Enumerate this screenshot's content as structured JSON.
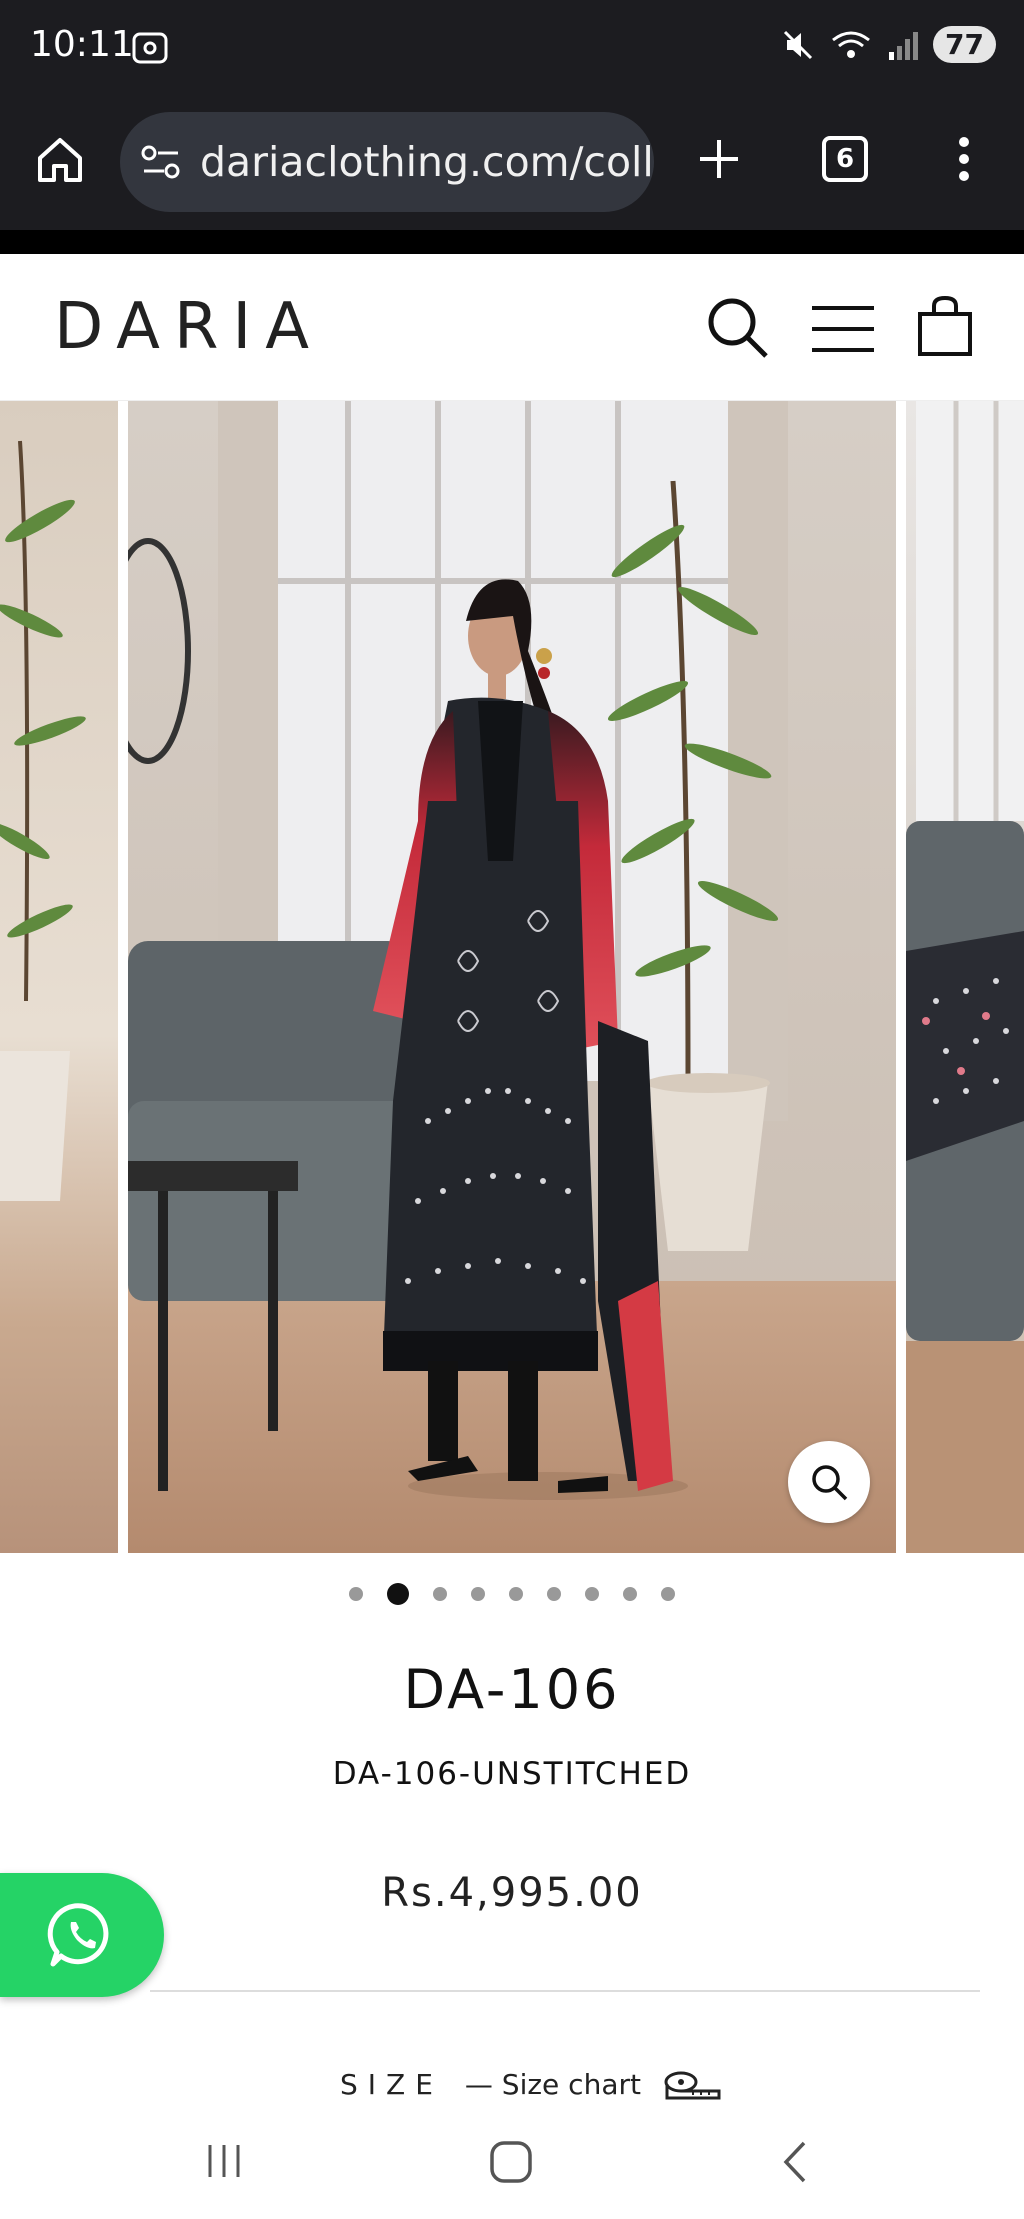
{
  "status_bar": {
    "time": "10:11",
    "battery": "77"
  },
  "browser": {
    "url": "dariaclothing.com/collec",
    "tab_count": "6"
  },
  "site": {
    "logo": "DARIA"
  },
  "carousel": {
    "slide_count": 9,
    "active_index": 1
  },
  "product": {
    "title": "DA-106",
    "sku": "DA-106-UNSTITCHED",
    "price": "Rs.4,995.00"
  },
  "size": {
    "label": "SIZE",
    "size_chart": "— Size chart"
  },
  "colors": {
    "whatsapp_green": "#25d366",
    "browser_bar": "#1c1c20"
  },
  "icons": [
    "home-icon",
    "site-settings-icon",
    "plus-icon",
    "tabs-icon",
    "more-menu-icon",
    "search-icon",
    "menu-icon",
    "bag-icon",
    "zoom-icon",
    "whatsapp-icon",
    "ruler-icon",
    "recents-icon",
    "home-nav-icon",
    "back-icon"
  ]
}
